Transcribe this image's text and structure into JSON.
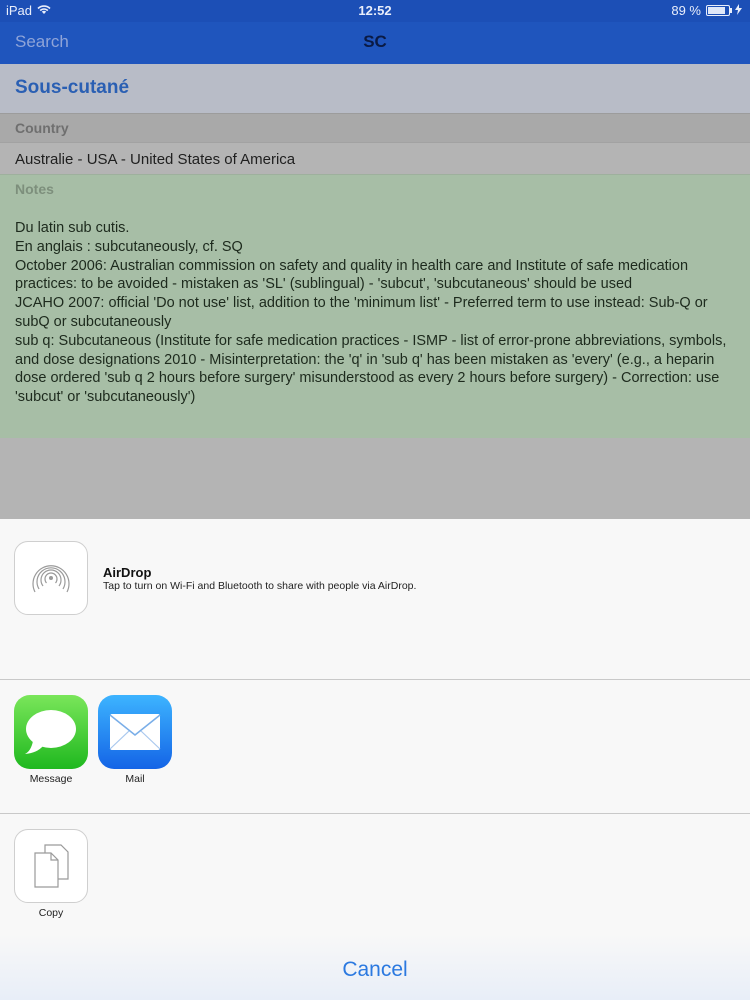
{
  "status_bar": {
    "device": "iPad",
    "time": "12:52",
    "battery": "89 %"
  },
  "nav_bar": {
    "search_label": "Search",
    "title": "SC"
  },
  "detail": {
    "title": "Sous-cutané",
    "country_label": "Country",
    "country_value": "Australie - USA - United States of America",
    "notes_label": "Notes",
    "notes_lines": [
      "Du latin sub cutis.",
      "En anglais : subcutaneously, cf. SQ",
      "October 2006: Australian commission on safety and quality in health care and Institute of safe medication practices: to be avoided - mistaken as 'SL' (sublingual) - 'subcut', 'subcutaneous' should be used",
      "JCAHO 2007: official 'Do not use' list, addition to the 'minimum list' - Preferred term to use instead: Sub-Q or subQ or subcutaneously",
      "sub q:  Subcutaneous (Institute for safe medication practices - ISMP - list of error-prone abbreviations, symbols, and dose designations 2010 - Misinterpretation: the 'q' in 'sub q' has been mistaken as 'every' (e.g., a heparin dose ordered 'sub q 2 hours before surgery' misunderstood as every 2 hours before surgery) - Correction: use 'subcut' or 'subcutaneously')"
    ]
  },
  "share_sheet": {
    "airdrop": {
      "title": "AirDrop",
      "description": "Tap to turn on Wi-Fi and Bluetooth to share with people via AirDrop."
    },
    "apps": [
      {
        "label": "Message",
        "icon": "message-bubble-icon",
        "color": "#34c759"
      },
      {
        "label": "Mail",
        "icon": "envelope-icon",
        "color": "#1a7cf0"
      }
    ],
    "actions": [
      {
        "label": "Copy",
        "icon": "copy-documents-icon"
      }
    ],
    "cancel_label": "Cancel"
  }
}
